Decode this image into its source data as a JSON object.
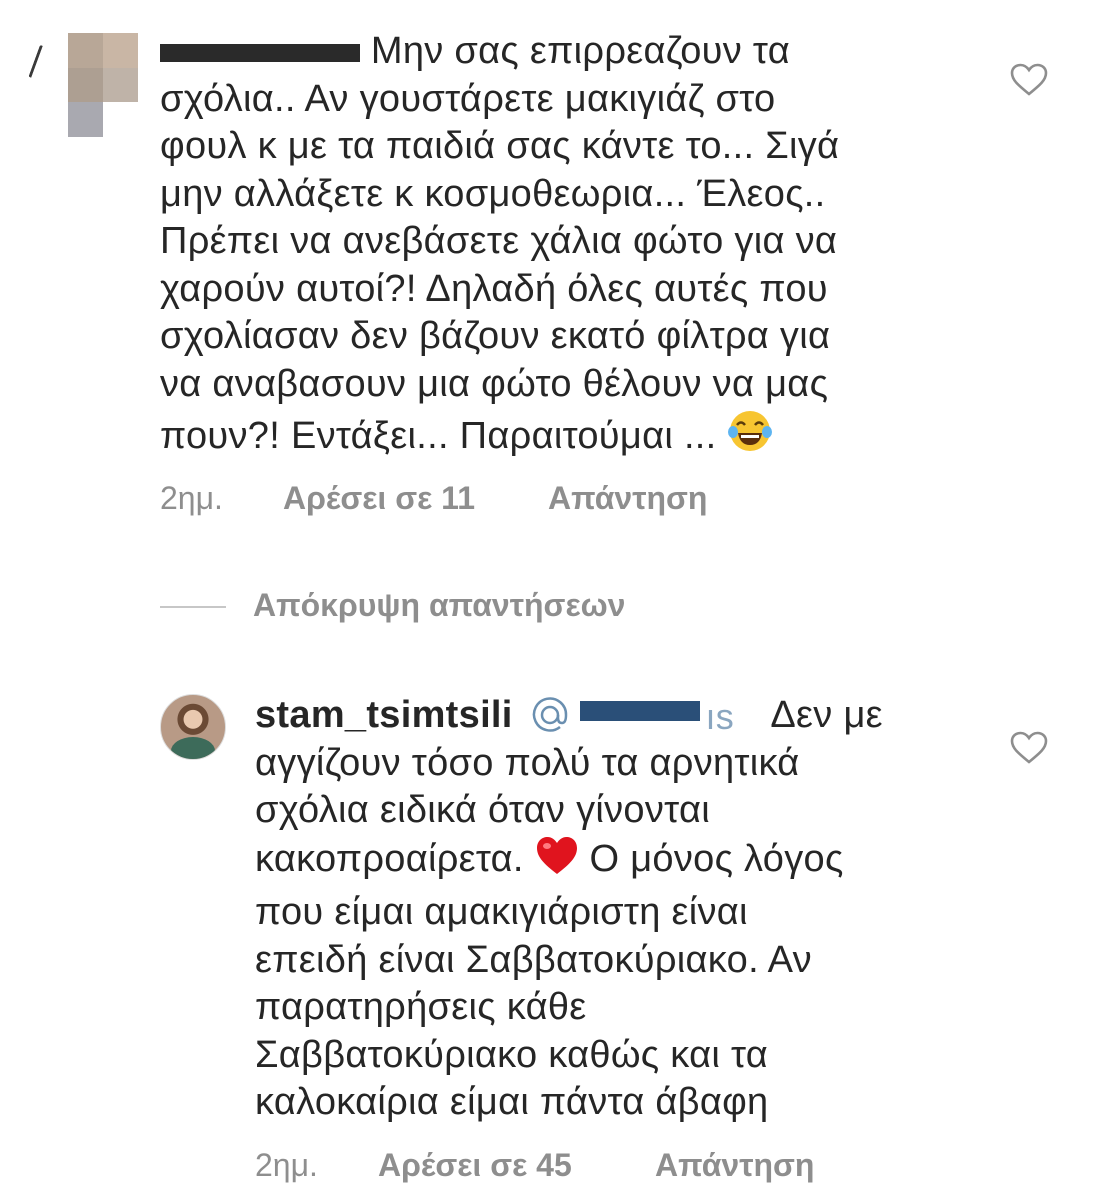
{
  "comments": [
    {
      "username": "",
      "lines": [
        "Μην σας επιρρεαζουν τα",
        "σχόλια.. Αν γουστάρετε μακιγιάζ στο",
        "φουλ κ με τα παιδιά σας κάντε το... Σιγά",
        "μην αλλάξετε κ κοσμοθεωρια... Έλεος..",
        "Πρέπει να ανεβάσετε χάλια φώτο για να",
        "χαρούν αυτοί?! Δηλαδή όλες αυτές που",
        "σχολίασαν δεν βάζουν εκατό φίλτρα για",
        "να αναβασουν μια φώτο θέλουν να μας",
        "πουν?! Εντάξει... Παραιτούμαι ..."
      ],
      "emoji": "😂",
      "time": "2ημ.",
      "likes": "Αρέσει σε 11",
      "reply": "Απάντηση",
      "like_icon": "heart-outline-icon"
    },
    {
      "username": "stam_tsimtsili",
      "mention": "@g...s",
      "first_line_rest": "Δεν με",
      "lines_before_emoji": [
        "αγγίζουν τόσο πολύ τα αρνητικά",
        "σχόλια ειδικά όταν γίνονται",
        "κακοπροαίρετα."
      ],
      "emoji": "❤️",
      "emoji_line_rest": "Ο μόνος λόγος",
      "lines_after": [
        "που είμαι αμακιγιάριστη είναι",
        "επειδή είναι Σαββατοκύριακο. Αν",
        "παρατηρήσεις κάθε",
        "Σαββατοκύριακο καθώς και τα",
        "καλοκαίρια είμαι πάντα άβαφη"
      ],
      "time": "2ημ.",
      "likes": "Αρέσει σε 45",
      "reply": "Απάντηση",
      "like_icon": "heart-outline-icon"
    }
  ],
  "hide_replies_label": "Απόκρυψη απαντήσεων",
  "colors": {
    "text": "#262626",
    "secondary": "#8e8e8e",
    "divider": "#c7c7c7"
  }
}
